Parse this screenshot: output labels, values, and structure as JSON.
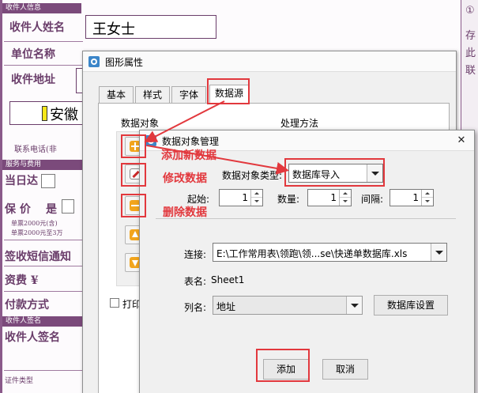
{
  "background_form": {
    "recipient_section": "收件人信息",
    "recipient_name_label": "收件人姓名",
    "recipient_name_value": "王女士",
    "company_label": "单位名称",
    "address_label": "收件地址",
    "address_value": "安徽",
    "contact_label": "联系电话(非",
    "service_section": "服务与费用",
    "same_day_label": "当日达",
    "insured_label": "保 价",
    "insured_opt": "是",
    "note_line1": "单票2000元(含)",
    "note_line2": "单票2000元至3万",
    "sms_label": "签收短信通知",
    "fee_label": "资费 ¥",
    "payment_label": "付款方式",
    "signature_section": "收件人签名",
    "signature_label": "收件人签名",
    "footer_label": "证件类型",
    "right_strip": [
      "①",
      "存",
      "此",
      "联"
    ]
  },
  "back_dialog": {
    "title": "图形属性",
    "tabs": [
      "基本",
      "样式",
      "字体",
      "数据源"
    ],
    "active_tab": "数据源",
    "data_object_label": "数据对象",
    "processing_label": "处理方法",
    "print_checkbox_label": "打印时"
  },
  "front_dialog": {
    "title": "数据对象管理",
    "type_label": "数据对象类型:",
    "type_value": "数据库导入",
    "start_label": "起始:",
    "start_value": "1",
    "count_label": "数量:",
    "count_value": "1",
    "interval_label": "间隔:",
    "interval_value": "1",
    "connect_label": "连接:",
    "connect_value": "E:\\工作常用表\\领跑\\领...se\\快递单数据库.xls",
    "table_label": "表名:",
    "table_value": "Sheet1",
    "column_label": "列名:",
    "column_value": "地址",
    "db_settings_button": "数据库设置",
    "add_button": "添加",
    "cancel_button": "取消",
    "close_glyph": "✕"
  },
  "annotations": {
    "add_new_data": "添加新数据",
    "modify_data": "修改数据",
    "delete_data": "删除数据"
  },
  "colors": {
    "highlight": "#e2383d",
    "form_purple": "#7b4a7b",
    "window_bg": "#f0f0f0",
    "icon_orange": "#f2a51d"
  }
}
